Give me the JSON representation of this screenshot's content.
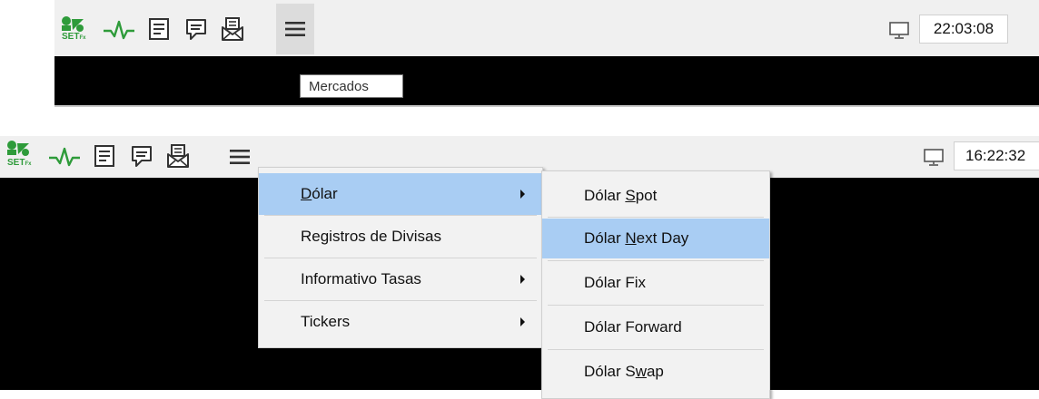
{
  "top": {
    "logo_text": "SET",
    "logo_sub": "Fx",
    "clock": "22:03:08",
    "tooltip": "Mercados"
  },
  "bottom": {
    "logo_text": "SET",
    "logo_sub": "Fx",
    "clock": "16:22:32",
    "menu": {
      "items": [
        {
          "pre": "",
          "u": "D",
          "post": "ólar",
          "has_submenu": true,
          "highlighted": true
        },
        {
          "pre": "Registros de Divisas",
          "u": "",
          "post": "",
          "has_submenu": false,
          "highlighted": false
        },
        {
          "pre": "Informativo Tasas",
          "u": "",
          "post": "",
          "has_submenu": true,
          "highlighted": false
        },
        {
          "pre": "Tickers",
          "u": "",
          "post": "",
          "has_submenu": true,
          "highlighted": false
        }
      ]
    },
    "submenu": {
      "items": [
        {
          "pre": "Dólar ",
          "u": "S",
          "post": "pot",
          "highlighted": false
        },
        {
          "pre": "Dólar ",
          "u": "N",
          "post": "ext Day",
          "highlighted": true
        },
        {
          "pre": "Dólar Fix",
          "u": "",
          "post": "",
          "highlighted": false
        },
        {
          "pre": "Dólar Forward",
          "u": "",
          "post": "",
          "highlighted": false
        },
        {
          "pre": "Dólar S",
          "u": "w",
          "post": "ap",
          "highlighted": false
        }
      ]
    }
  },
  "colors": {
    "logo_green": "#2e9b3a",
    "highlight": "#a9cdf3",
    "menu_bg": "#f2f2f2",
    "toolbar_bg": "#f0f0f0"
  }
}
